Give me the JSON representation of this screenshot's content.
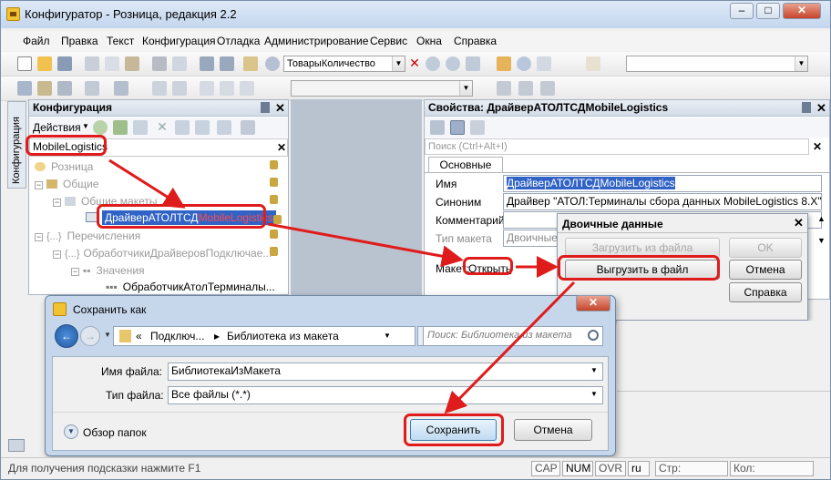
{
  "app": {
    "title": "Конфигуратор - Розница, редакция 2.2",
    "minimize": "–",
    "maximize": "□",
    "close": "✕"
  },
  "menu": {
    "items": [
      {
        "label": "Файл"
      },
      {
        "label": "Правка"
      },
      {
        "label": "Текст"
      },
      {
        "label": "Конфигурация"
      },
      {
        "label": "Отладка"
      },
      {
        "label": "Администрирование"
      },
      {
        "label": "Сервис"
      },
      {
        "label": "Окна"
      },
      {
        "label": "Справка"
      }
    ]
  },
  "toolbar": {
    "search_combo_value": "ТоварыКоличество"
  },
  "config_panel": {
    "title": "Конфигурация",
    "actions_label": "Действия",
    "search_value": "MobileLogistics",
    "tree": [
      {
        "label": "Розница",
        "level": 0,
        "active": false
      },
      {
        "label": "Общие",
        "level": 1,
        "active": false
      },
      {
        "label": "Общие макеты",
        "level": 2,
        "active": false
      },
      {
        "label_prefix": "ДрайверАТОЛТСД",
        "label_highlight": "MobileLogistics",
        "level": 3,
        "active": true
      },
      {
        "label": "Перечисления",
        "level": 1,
        "active": false
      },
      {
        "label": "ОбработчикиДрайверовПодключае...",
        "level": 2,
        "active": false
      },
      {
        "label": "Значения",
        "level": 3,
        "active": false
      },
      {
        "label": "ОбработчикАтолТерминалы...",
        "level": 4,
        "active": true
      }
    ],
    "side_tab": "Конфигурация"
  },
  "properties_panel": {
    "title": "Свойства: ДрайверАТОЛТСДMobileLogistics",
    "search_placeholder": "Поиск (Ctrl+Alt+I)",
    "tab_main": "Основные",
    "name_label": "Имя",
    "name_value": "ДрайверАТОЛТСДMobileLogistics",
    "synonym_label": "Синоним",
    "synonym_value": "Драйвер \"АТОЛ:Терминалы сбора данных MobileLogistics 8.X\"",
    "comment_label": "Комментарий",
    "comment_value": "",
    "layout_type_label": "Тип макета",
    "layout_type_value": "Двоичные ,",
    "maket_label": "Макет:",
    "open_link": "Открыть"
  },
  "binary_dialog": {
    "title": "Двоичные данные",
    "load_label": "Загрузить из файла",
    "ok_label": "OK",
    "export_label": "Выгрузить в файл",
    "cancel_label": "Отмена",
    "help_label": "Справка"
  },
  "save_dialog": {
    "title": "Сохранить как",
    "breadcrumb_prefix": "«",
    "breadcrumb_1": "Подключ...",
    "breadcrumb_2": "Библиотека из макета",
    "search_placeholder": "Поиск: Библиотека из макета",
    "filename_label": "Имя файла:",
    "filename_value": "БиблиотекаИзМакета",
    "filetype_label": "Тип файла:",
    "filetype_value": "Все файлы (*.*)",
    "browse_folders": "Обзор папок",
    "save_label": "Сохранить",
    "cancel_label": "Отмена"
  },
  "status": {
    "hint": "Для получения подсказки нажмите F1",
    "cap": "CAP",
    "num": "NUM",
    "ovr": "OVR",
    "lang": "ru",
    "line": "Стр:",
    "col": "Кол:"
  },
  "colors": {
    "annotation_red": "#e01b1b",
    "selection_blue": "#3163c6",
    "highlight_text": "#ff3a3a"
  }
}
